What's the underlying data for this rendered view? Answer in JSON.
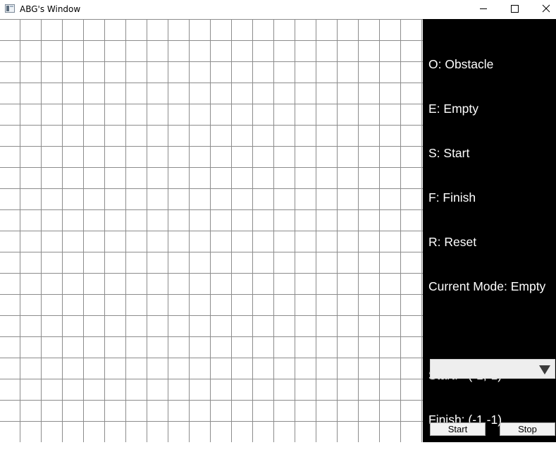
{
  "window": {
    "title": "ABG's Window"
  },
  "panel": {
    "legend": [
      "O: Obstacle",
      "E: Empty",
      "S: Start",
      "F: Finish",
      "R: Reset"
    ],
    "current_mode_label": "Current Mode: Empty",
    "start_label": "Start:   (-1,-1)",
    "finish_label": "Finish: (-1,-1)",
    "dropdown_value": "",
    "start_button": "Start",
    "stop_button": "Stop"
  },
  "colors": {
    "panel_background": "#000000",
    "grid_line": "#8c8c8c",
    "text": "#ffffff"
  }
}
